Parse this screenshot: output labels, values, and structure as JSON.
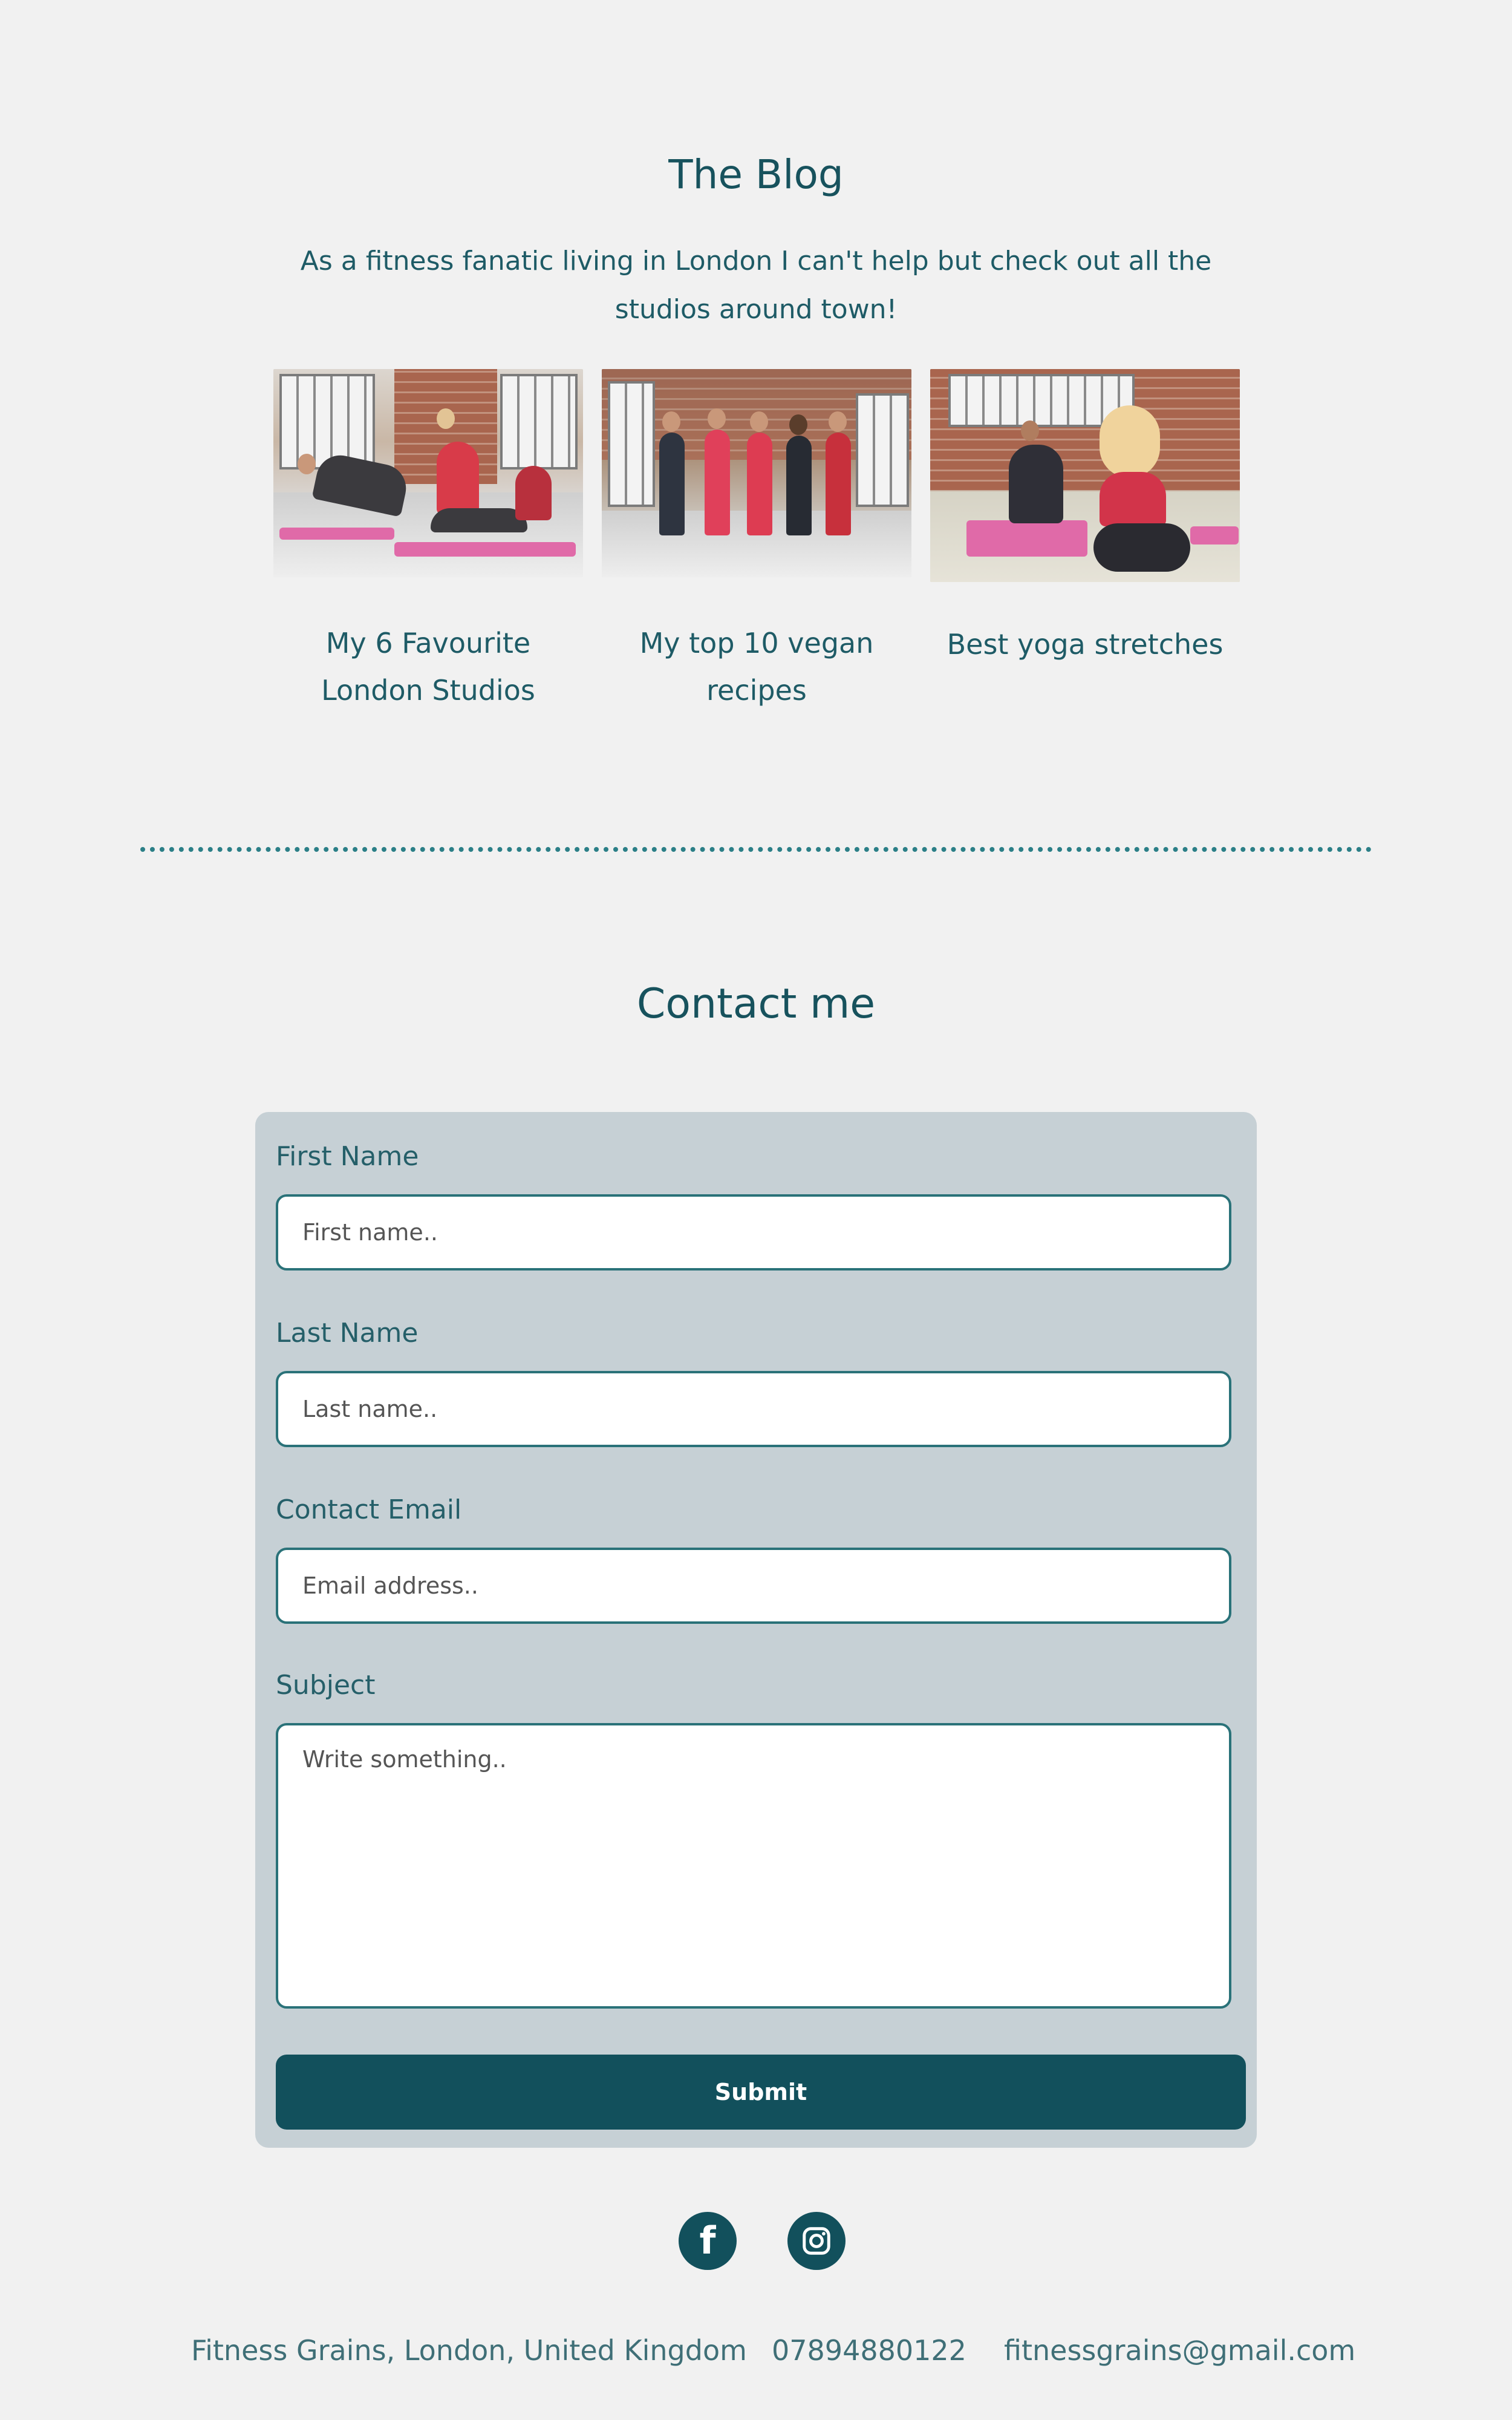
{
  "blog": {
    "title": "The Blog",
    "intro": "As a fitness fanatic living in London I can't help but check out all the studios around town!",
    "posts": [
      {
        "caption": "My 6 Favourite London Studios"
      },
      {
        "caption": "My top 10 vegan recipes"
      },
      {
        "caption": "Best yoga stretches"
      }
    ]
  },
  "contact": {
    "title": "Contact me",
    "first_name": {
      "label": "First Name",
      "placeholder": "First name.."
    },
    "last_name": {
      "label": "Last Name",
      "placeholder": "Last name.."
    },
    "email": {
      "label": "Contact Email",
      "placeholder": "Email address.."
    },
    "subject": {
      "label": "Subject",
      "placeholder": "Write something.."
    },
    "submit_label": "Submit"
  },
  "social": {
    "facebook_glyph": "f",
    "icons": [
      "facebook-icon",
      "instagram-icon"
    ]
  },
  "footer": {
    "address": "Fitness Grains, London, United Kingdom",
    "phone": "07894880122",
    "email": "fitnessgrains@gmail.com"
  },
  "colors": {
    "background": "#f1f1f1",
    "primary": "#12505c",
    "form_background": "#c6d0d5",
    "text": "#1d5b66"
  }
}
